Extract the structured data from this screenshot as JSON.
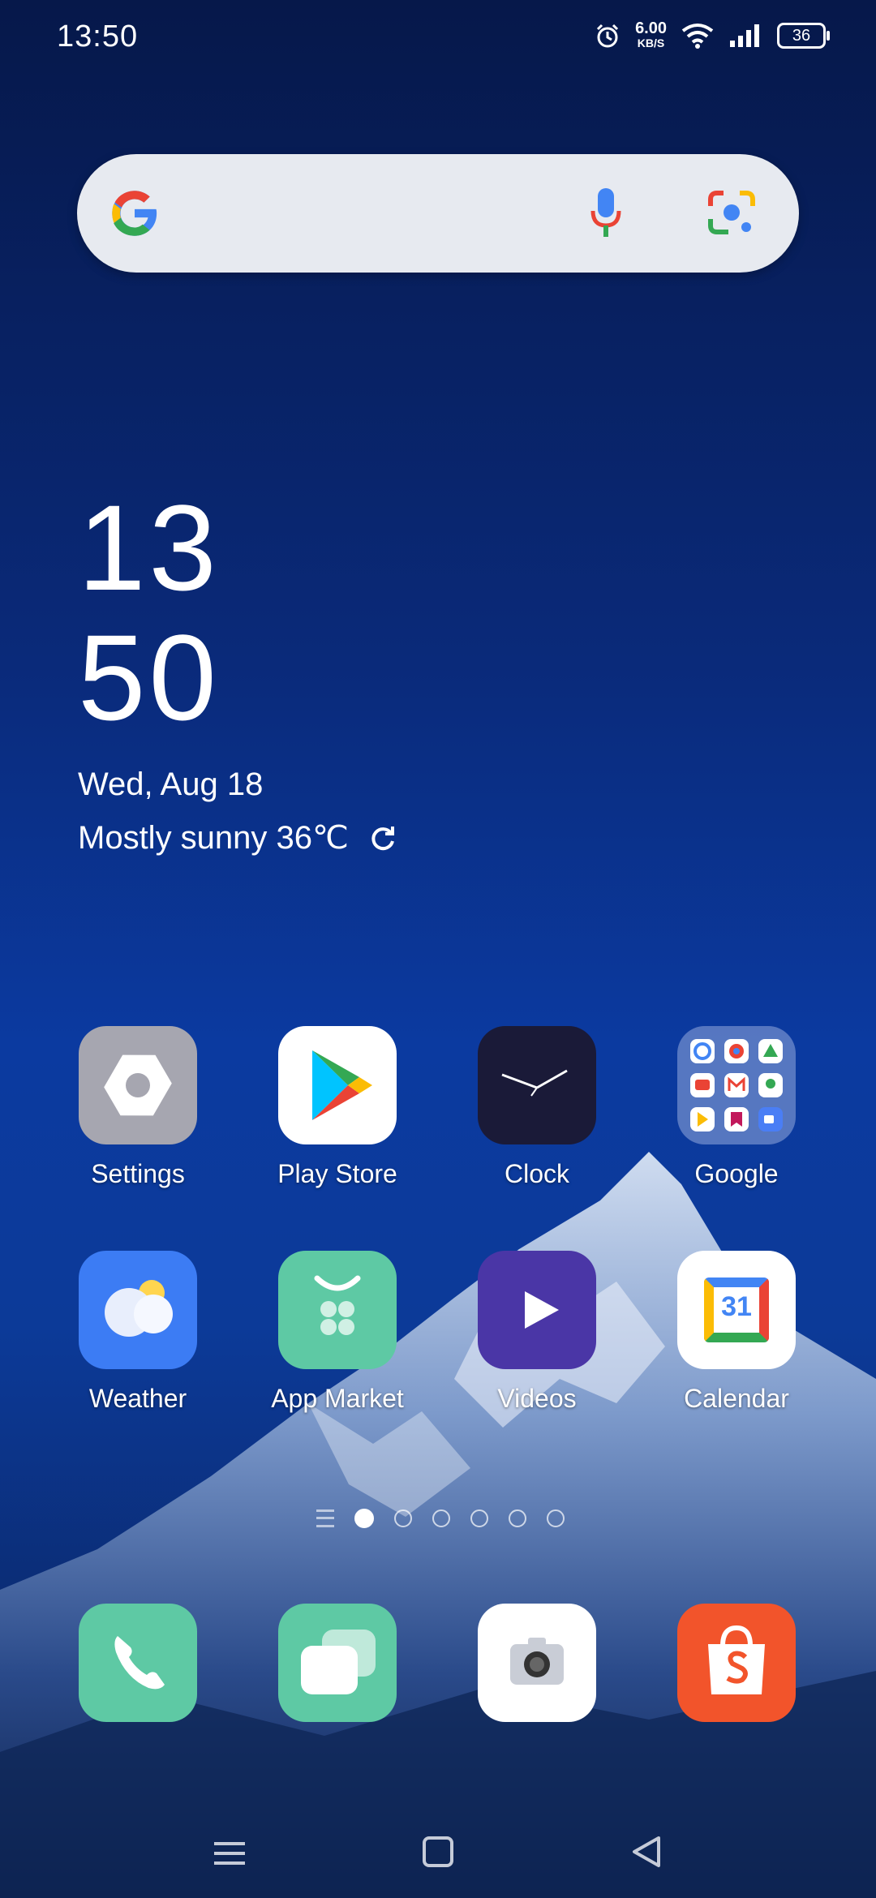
{
  "status_bar": {
    "time": "13:50",
    "speed_value": "6.00",
    "speed_unit": "KB/S",
    "battery": "36"
  },
  "search": {
    "engine": "Google"
  },
  "clock_widget": {
    "hour": "13",
    "minute": "50",
    "date": "Wed, Aug 18",
    "weather": "Mostly sunny 36℃"
  },
  "apps": [
    {
      "label": "Settings"
    },
    {
      "label": "Play Store"
    },
    {
      "label": "Clock"
    },
    {
      "label": "Google"
    },
    {
      "label": "Weather"
    },
    {
      "label": "App Market"
    },
    {
      "label": "Videos"
    },
    {
      "label": "Calendar",
      "day": "31"
    }
  ],
  "dock": [
    "Phone",
    "Messages",
    "Camera",
    "Shopee"
  ],
  "page_indicator": {
    "pages": 6,
    "current": 1
  },
  "colors": {
    "accent_blue": "#0b3aa0",
    "settings_gray": "#a6a6b0",
    "weather_blue": "#3c7cf4",
    "market_green": "#5ec9a4",
    "videos_purple": "#4a36a6",
    "shopee_orange": "#f2542b"
  }
}
